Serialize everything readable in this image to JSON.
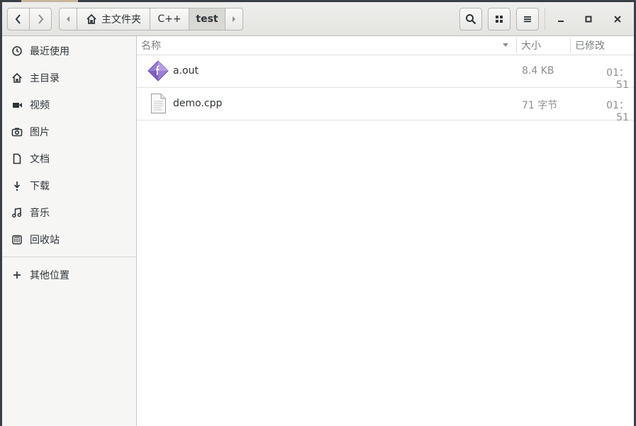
{
  "header": {
    "path": [
      "主文件夹",
      "C++",
      "test"
    ]
  },
  "sidebar": {
    "items": [
      {
        "label": "最近使用",
        "icon": "clock-icon"
      },
      {
        "label": "主目录",
        "icon": "home-icon"
      },
      {
        "label": "视频",
        "icon": "video-icon"
      },
      {
        "label": "图片",
        "icon": "camera-icon"
      },
      {
        "label": "文档",
        "icon": "document-icon"
      },
      {
        "label": "下载",
        "icon": "download-icon"
      },
      {
        "label": "音乐",
        "icon": "music-icon"
      },
      {
        "label": "回收站",
        "icon": "trash-icon"
      }
    ],
    "other": {
      "label": "其他位置",
      "icon": "plus-icon"
    }
  },
  "columns": {
    "name": "名称",
    "size": "大小",
    "modified": "已修改"
  },
  "files": [
    {
      "name": "a.out",
      "size": "8.4 KB",
      "modified": "01：51",
      "icon": "executable-icon"
    },
    {
      "name": "demo.cpp",
      "size": "71 字节",
      "modified": "01：51",
      "icon": "text-file-icon"
    }
  ],
  "colors": {
    "headerbar": "#e8e8e6",
    "sidebar": "#f6f6f5",
    "accent": "#8c6fc7"
  }
}
